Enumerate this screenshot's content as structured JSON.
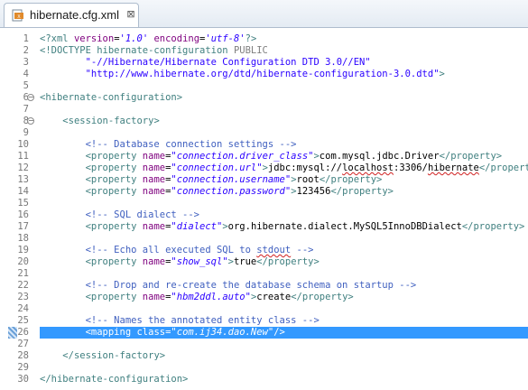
{
  "tab": {
    "title": "hibernate.cfg.xml",
    "icon": "xml-file-icon",
    "close_glyph": "⊠"
  },
  "editor": {
    "highlight_line": 26,
    "lines": [
      {
        "n": "1",
        "t": [
          [
            "pi",
            "<?xml "
          ],
          [
            "attr",
            "version"
          ],
          [
            "txt",
            "="
          ],
          [
            "val",
            "'1.0'"
          ],
          [
            "txt",
            " "
          ],
          [
            "attr",
            "encoding"
          ],
          [
            "txt",
            "="
          ],
          [
            "val",
            "'utf-8'"
          ],
          [
            "pi",
            "?>"
          ]
        ]
      },
      {
        "n": "2",
        "t": [
          [
            "doc",
            "<!DOCTYPE hibernate-configuration "
          ],
          [
            "kw",
            "PUBLIC"
          ]
        ]
      },
      {
        "n": "3",
        "t": [
          [
            "txt",
            "        "
          ],
          [
            "dstr",
            "\"-//Hibernate/Hibernate Configuration DTD 3.0//EN\""
          ]
        ]
      },
      {
        "n": "4",
        "t": [
          [
            "txt",
            "        "
          ],
          [
            "dstr",
            "\"http://www.hibernate.org/dtd/hibernate-configuration-3.0.dtd\""
          ],
          [
            "doc",
            ">"
          ]
        ]
      },
      {
        "n": "5",
        "t": []
      },
      {
        "n": "6",
        "fold": true,
        "t": [
          [
            "tag",
            "<hibernate-configuration>"
          ]
        ]
      },
      {
        "n": "7",
        "t": []
      },
      {
        "n": "8",
        "fold": true,
        "t": [
          [
            "txt",
            "    "
          ],
          [
            "tag",
            "<session-factory>"
          ]
        ]
      },
      {
        "n": "9",
        "t": []
      },
      {
        "n": "10",
        "t": [
          [
            "txt",
            "        "
          ],
          [
            "cmt",
            "<!-- Database connection settings -->"
          ]
        ]
      },
      {
        "n": "11",
        "t": [
          [
            "txt",
            "        "
          ],
          [
            "tag",
            "<property "
          ],
          [
            "attr",
            "name"
          ],
          [
            "txt",
            "="
          ],
          [
            "val",
            "\"connection.driver_class\""
          ],
          [
            "tag",
            ">"
          ],
          [
            "txt",
            "com.mysql.jdbc.Driver"
          ],
          [
            "tag",
            "</property>"
          ]
        ]
      },
      {
        "n": "12",
        "t": [
          [
            "txt",
            "        "
          ],
          [
            "tag",
            "<property "
          ],
          [
            "attr",
            "name"
          ],
          [
            "txt",
            "="
          ],
          [
            "val",
            "\"connection.url\""
          ],
          [
            "tag",
            ">"
          ],
          [
            "txt",
            "jdbc:mysql://"
          ],
          [
            "sq",
            "localhost"
          ],
          [
            "txt",
            ":3306/"
          ],
          [
            "sq",
            "hibernate"
          ],
          [
            "tag",
            "</property>"
          ]
        ]
      },
      {
        "n": "13",
        "t": [
          [
            "txt",
            "        "
          ],
          [
            "tag",
            "<property "
          ],
          [
            "attr",
            "name"
          ],
          [
            "txt",
            "="
          ],
          [
            "val",
            "\"connection.username\""
          ],
          [
            "tag",
            ">"
          ],
          [
            "txt",
            "root"
          ],
          [
            "tag",
            "</property>"
          ]
        ]
      },
      {
        "n": "14",
        "t": [
          [
            "txt",
            "        "
          ],
          [
            "tag",
            "<property "
          ],
          [
            "attr",
            "name"
          ],
          [
            "txt",
            "="
          ],
          [
            "val",
            "\"connection.password\""
          ],
          [
            "tag",
            ">"
          ],
          [
            "txt",
            "123456"
          ],
          [
            "tag",
            "</property>"
          ]
        ]
      },
      {
        "n": "15",
        "t": []
      },
      {
        "n": "16",
        "t": [
          [
            "txt",
            "        "
          ],
          [
            "cmt",
            "<!-- SQL dialect -->"
          ]
        ]
      },
      {
        "n": "17",
        "t": [
          [
            "txt",
            "        "
          ],
          [
            "tag",
            "<property "
          ],
          [
            "attr",
            "name"
          ],
          [
            "txt",
            "="
          ],
          [
            "val",
            "\"dialect\""
          ],
          [
            "tag",
            ">"
          ],
          [
            "txt",
            "org.hibernate.dialect.MySQL5InnoDBDialect"
          ],
          [
            "tag",
            "</property>"
          ]
        ]
      },
      {
        "n": "18",
        "t": []
      },
      {
        "n": "19",
        "t": [
          [
            "txt",
            "        "
          ],
          [
            "cmt",
            "<!-- Echo all executed SQL to "
          ],
          [
            "cmtsq",
            "stdout"
          ],
          [
            "cmt",
            " -->"
          ]
        ]
      },
      {
        "n": "20",
        "t": [
          [
            "txt",
            "        "
          ],
          [
            "tag",
            "<property "
          ],
          [
            "attr",
            "name"
          ],
          [
            "txt",
            "="
          ],
          [
            "val",
            "\"show_sql\""
          ],
          [
            "tag",
            ">"
          ],
          [
            "txt",
            "true"
          ],
          [
            "tag",
            "</property>"
          ]
        ]
      },
      {
        "n": "21",
        "t": []
      },
      {
        "n": "22",
        "t": [
          [
            "txt",
            "        "
          ],
          [
            "cmt",
            "<!-- Drop and re-create the database schema on startup -->"
          ]
        ]
      },
      {
        "n": "23",
        "t": [
          [
            "txt",
            "        "
          ],
          [
            "tag",
            "<property "
          ],
          [
            "attr",
            "name"
          ],
          [
            "txt",
            "="
          ],
          [
            "val",
            "\"hbm2ddl.auto\""
          ],
          [
            "tag",
            ">"
          ],
          [
            "txt",
            "create"
          ],
          [
            "tag",
            "</property>"
          ]
        ]
      },
      {
        "n": "24",
        "t": []
      },
      {
        "n": "25",
        "t": [
          [
            "txt",
            "        "
          ],
          [
            "cmt",
            "<!-- Names the annotated entity class -->"
          ]
        ]
      },
      {
        "n": "26",
        "t": [
          [
            "txt",
            "        "
          ],
          [
            "tag",
            "<mapping "
          ],
          [
            "attr",
            "class"
          ],
          [
            "txt",
            "="
          ],
          [
            "val",
            "\"com.ij34.dao.New\""
          ],
          [
            "tag",
            "/>"
          ]
        ]
      },
      {
        "n": "27",
        "t": []
      },
      {
        "n": "28",
        "t": [
          [
            "txt",
            "    "
          ],
          [
            "tag",
            "</session-factory>"
          ]
        ]
      },
      {
        "n": "29",
        "t": []
      },
      {
        "n": "30",
        "t": [
          [
            "tag",
            "</hibernate-configuration>"
          ]
        ]
      }
    ]
  },
  "colors": {
    "highlight": "#3399ff",
    "tag": "#3f7f7f",
    "attr": "#7f007f",
    "value": "#2a00ff",
    "comment": "#3f5fbf"
  }
}
